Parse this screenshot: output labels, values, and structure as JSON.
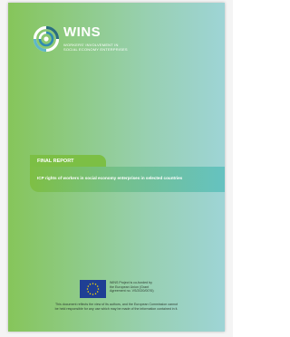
{
  "brand": {
    "name": "WINS",
    "tagline_line1": "WORKERS' INVOLVEMENT IN",
    "tagline_line2": "SOCIAL ECONOMY ENTERPRISES"
  },
  "report": {
    "label": "FINAL REPORT",
    "title": "ICP rights of workers in social economy enterprises in selected countries"
  },
  "funding": {
    "line1": "WINS Project is co-funded by",
    "line2": "the European Union (Grant",
    "line3": "Agreement no. VS/2020/0076)"
  },
  "disclaimer": {
    "line1": "This document reflects the view of its authors, and the European Commission cannot",
    "line2": "be held responsible for any use which may be made of the information contained in it."
  },
  "colors": {
    "green": "#86c55a",
    "teal": "#9ed4d6",
    "eu_blue": "#1f3f94",
    "eu_gold": "#ffdd00"
  },
  "icons": {
    "logo": "wins-swirl-logo",
    "flag": "eu-flag-icon"
  }
}
